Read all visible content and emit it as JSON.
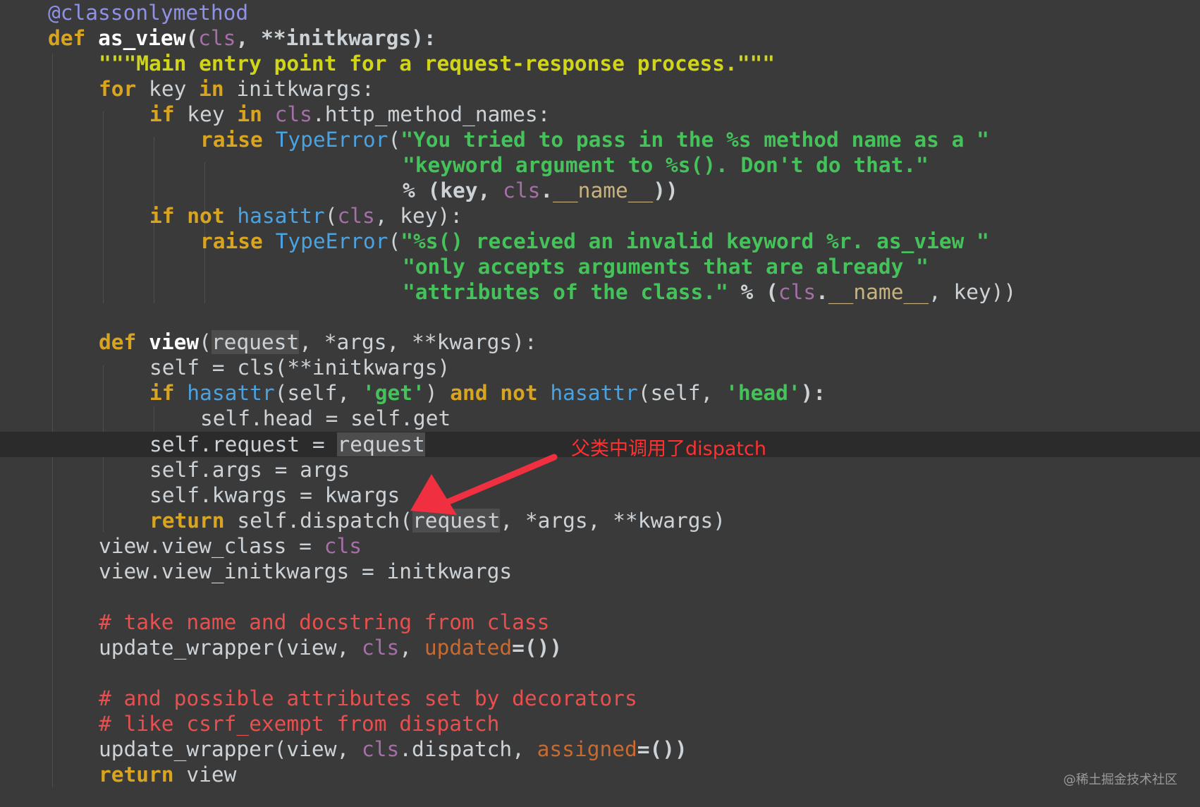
{
  "code": {
    "l1": {
      "decorator": "@classonlymethod"
    },
    "l2": {
      "kw": "def",
      "name": "as_view",
      "p1": "(",
      "cls": "cls",
      "p2": ", **initkwargs):"
    },
    "l3": {
      "docstring": "\"\"\"Main entry point for a request-response process.\"\"\""
    },
    "l4": {
      "kw1": "for",
      "t1": " key ",
      "kw2": "in",
      "t2": " initkwargs:"
    },
    "l5": {
      "kw1": "if",
      "t1": " key ",
      "kw2": "in",
      "sp": " ",
      "cls": "cls",
      "t2": ".http_method_names:"
    },
    "l6": {
      "kw": "raise",
      "sp": " ",
      "exc": "TypeError",
      "p": "(",
      "str": "\"You tried to pass in the %s method name as a \""
    },
    "l7": {
      "str": "\"keyword argument to %s(). Don't do that.\""
    },
    "l8": {
      "t1": "% (key, ",
      "cls": "cls",
      "dot": ".",
      "magic": "__name__",
      "t2": "))"
    },
    "l9": {
      "kw1": "if",
      "sp1": " ",
      "kw2": "not",
      "sp2": " ",
      "fn": "hasattr",
      "t1": "(",
      "cls": "cls",
      "t2": ", key):"
    },
    "l10": {
      "kw": "raise",
      "sp": " ",
      "exc": "TypeError",
      "p": "(",
      "str": "\"%s() received an invalid keyword %r. as_view \""
    },
    "l11": {
      "str": "\"only accepts arguments that are already \""
    },
    "l12": {
      "str": "\"attributes of the class.\"",
      "t1": " % (",
      "cls": "cls",
      "dot": ".",
      "magic": "__name__",
      "t2": ", key))"
    },
    "l13": {
      "kw": "def",
      "sp": " ",
      "name": "view",
      "p1": "(",
      "param": "request",
      "t1": ", *args, **kwargs):"
    },
    "l14": {
      "text": "self = cls(**initkwargs)"
    },
    "l15": {
      "kw1": "if",
      "sp1": " ",
      "fn1": "hasattr",
      "t1": "(self, ",
      "s1": "'get'",
      "t2": ") ",
      "kw2": "and",
      "sp2": " ",
      "kw3": "not",
      "sp3": " ",
      "fn2": "hasattr",
      "t3": "(self, ",
      "s2": "'head'",
      "t4": "):"
    },
    "l16": {
      "text": "self.head = self.get"
    },
    "l17": {
      "t1": "self.request = ",
      "param": "request"
    },
    "l18": {
      "text": "self.args = args"
    },
    "l19": {
      "text": "self.kwargs = kwargs"
    },
    "l20": {
      "kw": "return",
      "t1": " self.dispatch(",
      "param": "request",
      "t2": ", *args, **kwargs)"
    },
    "l21": {
      "t1": "view.view_class = ",
      "cls": "cls"
    },
    "l22": {
      "text": "view.view_initkwargs = initkwargs"
    },
    "l23": {
      "comment": "# take name and docstring from class"
    },
    "l24": {
      "t1": "update_wrapper(view, ",
      "cls": "cls",
      "t2": ", ",
      "kwarg": "updated",
      "t3": "=())"
    },
    "l25": {
      "comment": "# and possible attributes set by decorators"
    },
    "l26": {
      "comment": "# like csrf_exempt from dispatch"
    },
    "l27": {
      "t1": "update_wrapper(view, ",
      "cls": "cls",
      "t2": ".dispatch, ",
      "kwarg": "assigned",
      "t3": "=())"
    },
    "l28": {
      "kw": "return",
      "t1": " view"
    }
  },
  "annotation": {
    "text": "父类中调用了dispatch",
    "color": "#ff3030"
  },
  "watermark": {
    "text": "@稀土掘金技术社区"
  },
  "colors": {
    "background": "#3a3a3a",
    "current_line": "#2b2b2b",
    "keyword": "#d9a520",
    "string": "#45c25a",
    "comment": "#e8504f",
    "decorator": "#8f90e8",
    "builtin": "#4aa3e0",
    "self_cls": "#a56fa8"
  }
}
